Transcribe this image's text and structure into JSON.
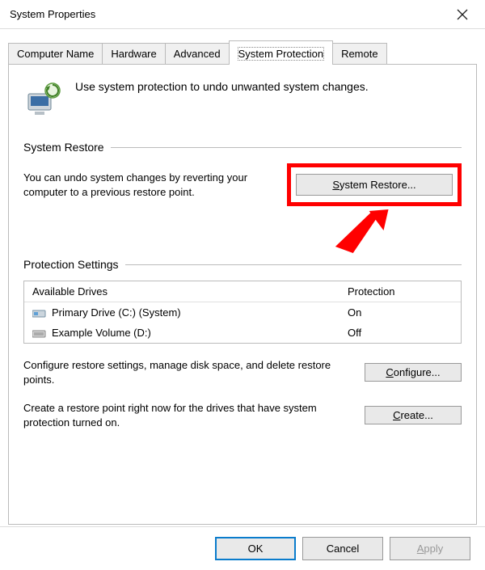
{
  "window": {
    "title": "System Properties",
    "close_label": "Close"
  },
  "tabs": {
    "computer_name": "Computer Name",
    "hardware": "Hardware",
    "advanced": "Advanced",
    "system_protection": "System Protection",
    "remote": "Remote"
  },
  "intro": "Use system protection to undo unwanted system changes.",
  "groups": {
    "restore_header": "System Restore",
    "restore_desc": "You can undo system changes by reverting your computer to a previous restore point.",
    "restore_btn_prefix": "S",
    "restore_btn_rest": "ystem Restore...",
    "protection_header": "Protection Settings",
    "drives_col_a": "Available Drives",
    "drives_col_b": "Protection",
    "drives": [
      {
        "name": "Primary Drive (C:) (System)",
        "protection": "On",
        "icon": "primary"
      },
      {
        "name": "Example Volume (D:)",
        "protection": "Off",
        "icon": "example"
      }
    ],
    "configure_desc": "Configure restore settings, manage disk space, and delete restore points.",
    "configure_btn_prefix": "C",
    "configure_btn_rest": "onfigure...",
    "create_desc": "Create a restore point right now for the drives that have system protection turned on.",
    "create_btn_prefix": "C",
    "create_btn_rest": "reate..."
  },
  "footer": {
    "ok": "OK",
    "cancel": "Cancel",
    "apply_prefix": "A",
    "apply_rest": "pply"
  }
}
